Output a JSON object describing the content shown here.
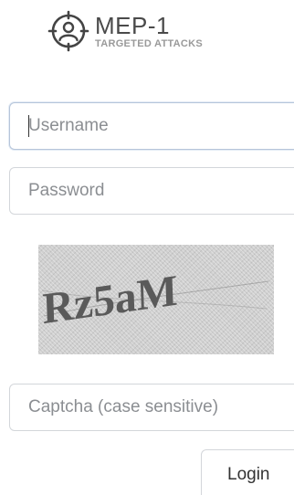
{
  "brand": {
    "title": "MEP-1",
    "subtitle": "TARGETED ATTACKS",
    "logo_icon": "user-target-icon"
  },
  "form": {
    "username": {
      "placeholder": "Username",
      "value": ""
    },
    "password": {
      "placeholder": "Password",
      "value": ""
    },
    "captcha": {
      "image_text": "Rz5aM",
      "placeholder": "Captcha (case sensitive)",
      "value": ""
    },
    "login_label": "Login"
  },
  "colors": {
    "border": "#d3d6da",
    "active_border": "#b6c5da",
    "placeholder": "#8b8e92",
    "captcha_bg": "#cfcfcf",
    "captcha_text": "#5a5a5a"
  }
}
